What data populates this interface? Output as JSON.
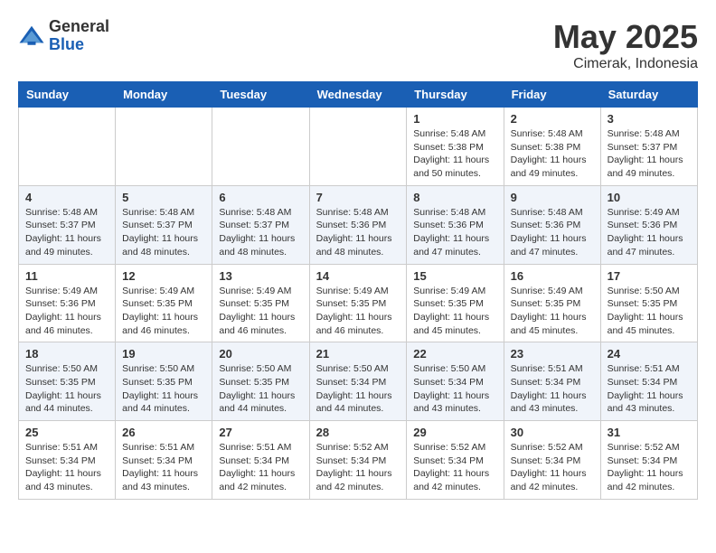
{
  "logo": {
    "general": "General",
    "blue": "Blue"
  },
  "title": "May 2025",
  "location": "Cimerak, Indonesia",
  "days_of_week": [
    "Sunday",
    "Monday",
    "Tuesday",
    "Wednesday",
    "Thursday",
    "Friday",
    "Saturday"
  ],
  "weeks": [
    [
      {
        "day": "",
        "info": ""
      },
      {
        "day": "",
        "info": ""
      },
      {
        "day": "",
        "info": ""
      },
      {
        "day": "",
        "info": ""
      },
      {
        "day": "1",
        "info": "Sunrise: 5:48 AM\nSunset: 5:38 PM\nDaylight: 11 hours and 50 minutes."
      },
      {
        "day": "2",
        "info": "Sunrise: 5:48 AM\nSunset: 5:38 PM\nDaylight: 11 hours and 49 minutes."
      },
      {
        "day": "3",
        "info": "Sunrise: 5:48 AM\nSunset: 5:37 PM\nDaylight: 11 hours and 49 minutes."
      }
    ],
    [
      {
        "day": "4",
        "info": "Sunrise: 5:48 AM\nSunset: 5:37 PM\nDaylight: 11 hours and 49 minutes."
      },
      {
        "day": "5",
        "info": "Sunrise: 5:48 AM\nSunset: 5:37 PM\nDaylight: 11 hours and 48 minutes."
      },
      {
        "day": "6",
        "info": "Sunrise: 5:48 AM\nSunset: 5:37 PM\nDaylight: 11 hours and 48 minutes."
      },
      {
        "day": "7",
        "info": "Sunrise: 5:48 AM\nSunset: 5:36 PM\nDaylight: 11 hours and 48 minutes."
      },
      {
        "day": "8",
        "info": "Sunrise: 5:48 AM\nSunset: 5:36 PM\nDaylight: 11 hours and 47 minutes."
      },
      {
        "day": "9",
        "info": "Sunrise: 5:48 AM\nSunset: 5:36 PM\nDaylight: 11 hours and 47 minutes."
      },
      {
        "day": "10",
        "info": "Sunrise: 5:49 AM\nSunset: 5:36 PM\nDaylight: 11 hours and 47 minutes."
      }
    ],
    [
      {
        "day": "11",
        "info": "Sunrise: 5:49 AM\nSunset: 5:36 PM\nDaylight: 11 hours and 46 minutes."
      },
      {
        "day": "12",
        "info": "Sunrise: 5:49 AM\nSunset: 5:35 PM\nDaylight: 11 hours and 46 minutes."
      },
      {
        "day": "13",
        "info": "Sunrise: 5:49 AM\nSunset: 5:35 PM\nDaylight: 11 hours and 46 minutes."
      },
      {
        "day": "14",
        "info": "Sunrise: 5:49 AM\nSunset: 5:35 PM\nDaylight: 11 hours and 46 minutes."
      },
      {
        "day": "15",
        "info": "Sunrise: 5:49 AM\nSunset: 5:35 PM\nDaylight: 11 hours and 45 minutes."
      },
      {
        "day": "16",
        "info": "Sunrise: 5:49 AM\nSunset: 5:35 PM\nDaylight: 11 hours and 45 minutes."
      },
      {
        "day": "17",
        "info": "Sunrise: 5:50 AM\nSunset: 5:35 PM\nDaylight: 11 hours and 45 minutes."
      }
    ],
    [
      {
        "day": "18",
        "info": "Sunrise: 5:50 AM\nSunset: 5:35 PM\nDaylight: 11 hours and 44 minutes."
      },
      {
        "day": "19",
        "info": "Sunrise: 5:50 AM\nSunset: 5:35 PM\nDaylight: 11 hours and 44 minutes."
      },
      {
        "day": "20",
        "info": "Sunrise: 5:50 AM\nSunset: 5:35 PM\nDaylight: 11 hours and 44 minutes."
      },
      {
        "day": "21",
        "info": "Sunrise: 5:50 AM\nSunset: 5:34 PM\nDaylight: 11 hours and 44 minutes."
      },
      {
        "day": "22",
        "info": "Sunrise: 5:50 AM\nSunset: 5:34 PM\nDaylight: 11 hours and 43 minutes."
      },
      {
        "day": "23",
        "info": "Sunrise: 5:51 AM\nSunset: 5:34 PM\nDaylight: 11 hours and 43 minutes."
      },
      {
        "day": "24",
        "info": "Sunrise: 5:51 AM\nSunset: 5:34 PM\nDaylight: 11 hours and 43 minutes."
      }
    ],
    [
      {
        "day": "25",
        "info": "Sunrise: 5:51 AM\nSunset: 5:34 PM\nDaylight: 11 hours and 43 minutes."
      },
      {
        "day": "26",
        "info": "Sunrise: 5:51 AM\nSunset: 5:34 PM\nDaylight: 11 hours and 43 minutes."
      },
      {
        "day": "27",
        "info": "Sunrise: 5:51 AM\nSunset: 5:34 PM\nDaylight: 11 hours and 42 minutes."
      },
      {
        "day": "28",
        "info": "Sunrise: 5:52 AM\nSunset: 5:34 PM\nDaylight: 11 hours and 42 minutes."
      },
      {
        "day": "29",
        "info": "Sunrise: 5:52 AM\nSunset: 5:34 PM\nDaylight: 11 hours and 42 minutes."
      },
      {
        "day": "30",
        "info": "Sunrise: 5:52 AM\nSunset: 5:34 PM\nDaylight: 11 hours and 42 minutes."
      },
      {
        "day": "31",
        "info": "Sunrise: 5:52 AM\nSunset: 5:34 PM\nDaylight: 11 hours and 42 minutes."
      }
    ]
  ]
}
